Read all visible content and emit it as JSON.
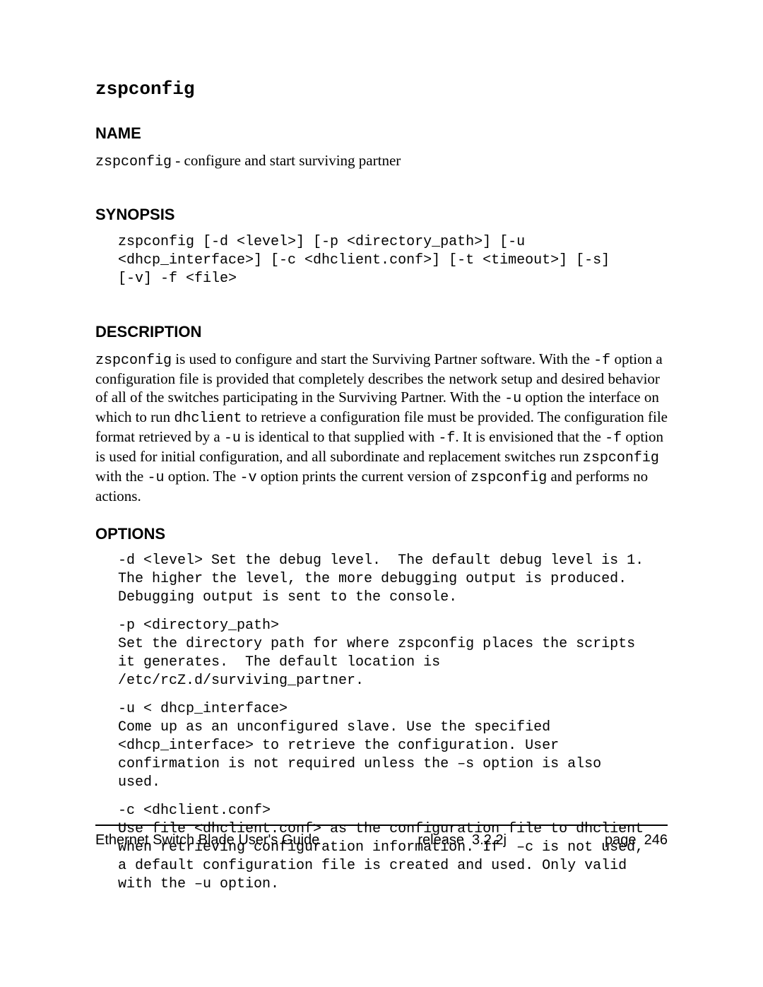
{
  "title": "zspconfig",
  "sections": {
    "name": {
      "heading": "NAME",
      "cmd": "zspconfig",
      "rest": " - configure and start surviving partner"
    },
    "synopsis": {
      "heading": "SYNOPSIS",
      "text": "zspconfig [-d <level>] [-p <directory_path>] [-u\n<dhcp_interface>] [-c <dhclient.conf>] [-t <timeout>] [-s]\n[-v] -f <file>"
    },
    "description": {
      "heading": "DESCRIPTION",
      "text_parts": {
        "p1_cmd0": " zspconfig",
        "p1_a": " is used to configure and start the Surviving Partner software.  With the ",
        "p1_flag_f": "-f",
        "p1_b": " option a configuration file is provided that completely describes the network setup and desired behavior of all of the switches participating in the Surviving Partner.  With the ",
        "p1_flag_u": "-u",
        "p1_c": " option the interface on which to run ",
        "p1_dhclient": "dhclient",
        "p1_d": " to retrieve a configuration file must be provided.  The configuration file format retrieved by a ",
        "p1_flag_u2": "-u",
        "p1_e": " is identical to that supplied with ",
        "p1_flag_f2": "-f",
        "p1_f": ".  It is envisioned that the ",
        "p1_flag_f3": "-f",
        "p1_g": " option is used for initial configuration, and all subordinate and replacement switches run ",
        "p1_cmd1": "zspconfig",
        "p1_h": " with the ",
        "p1_flag_u3": "-u",
        "p1_i": " option.  The ",
        "p1_flag_v": "-v",
        "p1_j": " option prints the current version of ",
        "p1_cmd2": "zspconfig",
        "p1_k": " and performs no actions."
      }
    },
    "options": {
      "heading": "OPTIONS",
      "items": [
        "-d <level> Set the debug level.  The default debug level is 1.\nThe higher the level, the more debugging output is produced.\nDebugging output is sent to the console.",
        "-p <directory_path>\nSet the directory path for where zspconfig places the scripts\nit generates.  The default location is\n/etc/rcZ.d/surviving_partner.",
        "-u < dhcp_interface>\nCome up as an unconfigured slave. Use the specified\n<dhcp_interface> to retrieve the configuration. User\nconfirmation is not required unless the –s option is also\nused.",
        "-c <dhclient.conf>\nUse file <dhclient.conf> as the configuration file to dhclient\nwhen retrieving configuration information. If  –c is not used,\na default configuration file is created and used. Only valid\nwith the –u option."
      ]
    }
  },
  "footer": {
    "doc_title": "Ethernet Switch Blade User's Guide",
    "release": "release  3.2.2j",
    "page": "page  246"
  }
}
